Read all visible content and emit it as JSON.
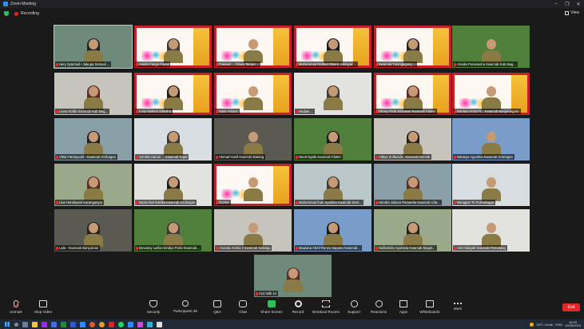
{
  "window": {
    "title": "Zoom Meeting"
  },
  "status": {
    "recording_label": "Recording",
    "view_label": "View"
  },
  "colors": {
    "record_red": "#e02828",
    "active_outline": "#f5d300",
    "banner_red": "#c8202a",
    "share_green": "#2fbf5a"
  },
  "participants": [
    "Hery Syamsul • Jakupa Semuel ...",
    "Aniefa Fanga Fanali",
    "Fawwaz ... Dawa Tarsan ...",
    "Muhammad Rabbul Dhaini...Hidayat ...",
    "Kwarcab Tulungagung ...",
    "Amalia Purwasuha Kwarcab Kab Mag...",
    "Liana Rafifa Kwarcab Kab Mag...",
    "Luna Nahma Zaifulha",
    "Sasa Arkana",
    "Hudaw ...",
    "Dhany Rafa Setiawan Kwarcab Klaten",
    "Dariana Ariza Pr... Kwarcab Banjarnegara",
    "Vibia Fatmayanti - Kwarcab Grobogan",
    "Siti Mia Hanun ... Kwarcab Tegal",
    "Ahmad Hanif Kwarcab Batang",
    "Nurul Ngafa Kwarcab Klaten",
    "Aditya Zulfanida...Kwarcab Demak",
    "Natasya Agustina Kwarcab Grobogan",
    "Lian Handayani Karanganyar",
    "Nazia Dwi Kartika Kwarcab Grobogan",
    "Guntur",
    "Muhammad Ihan Syahfan Kwarcab Dem...",
    "Hendra Juliano Pamaeha Kwarcab Cila...",
    "Ranggas Tri Purbalingga",
    "Lala - Kwarcab Banyumas",
    "Devanny Lutfia Heridya Putra Kwarcab...",
    "Ananda Ardela s Kwarcab Salatiga",
    "Maulana Ahmf Renza Saputra Kwarcab...",
    "Nafilatmila Aqurvida Kwarcab Magel...",
    "Aini Hidayati Kwarcab Pemalang",
    "A12 milk 14"
  ],
  "toolbar": {
    "unmute": "Unmute",
    "stop_video": "Stop Video",
    "security": "Security",
    "participants": "Participants",
    "participants_count": "38",
    "qa": "Q&A",
    "chat": "Chat",
    "share": "Share Screen",
    "record": "Record",
    "rooms": "Breakout Rooms",
    "support": "Support",
    "reactions": "Reactions",
    "apps": "Apps",
    "whiteboards": "Whiteboards",
    "more": "More",
    "end": "End"
  },
  "taskbar": {
    "weather": "33°C Cerah",
    "lang": "ENG",
    "time": "16:29",
    "date": "12/06/2023"
  }
}
